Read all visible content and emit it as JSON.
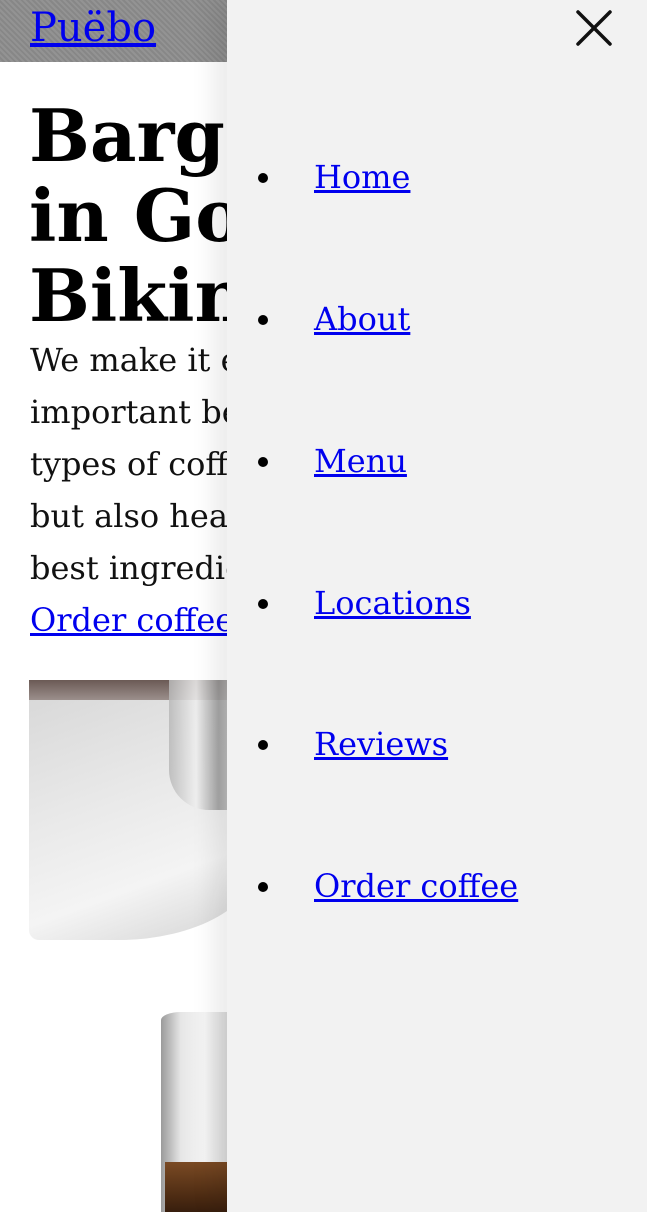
{
  "header": {
    "brand": "Puëbo"
  },
  "hero": {
    "title_lines": [
      "Barga",
      "in Go",
      "Bikin"
    ],
    "text_lines": [
      "We make it e",
      "important be",
      "types of coffe",
      "but also heal",
      "best ingredie"
    ],
    "order_link": "Order coffee"
  },
  "photo": {
    "icon": "coffee-pour-photo"
  },
  "menu": {
    "close_icon": "close-icon",
    "items": [
      {
        "label": "Home"
      },
      {
        "label": "About"
      },
      {
        "label": "Menu"
      },
      {
        "label": "Locations"
      },
      {
        "label": "Reviews"
      },
      {
        "label": "Order coffee"
      }
    ]
  },
  "colors": {
    "link": "#0000ee",
    "drawer_bg": "#f2f2f2",
    "header_bg": "#8c8c8c"
  }
}
